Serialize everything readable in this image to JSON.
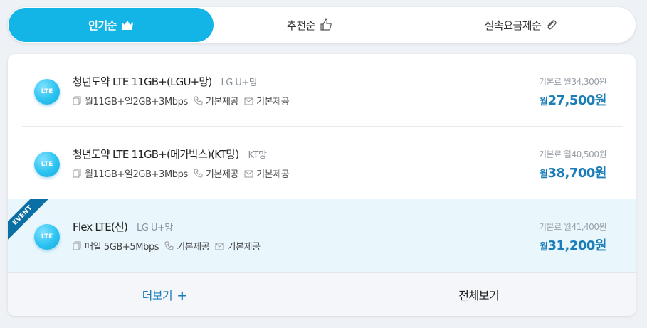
{
  "tabs": [
    {
      "label": "인기순",
      "icon": "crown-icon",
      "active": true
    },
    {
      "label": "추천순",
      "icon": "thumbs-up-icon",
      "active": false
    },
    {
      "label": "실속요금제순",
      "icon": "paperclip-icon",
      "active": false
    }
  ],
  "plans": [
    {
      "badge": "LTE",
      "name": "청년도약 LTE 11GB+(LGU+망)",
      "network": "LG U+망",
      "data": "월11GB+일2GB+3Mbps",
      "voice": "기본제공",
      "sms": "기본제공",
      "original_price": "기본료 월34,300원",
      "sale_prefix": "월",
      "sale_price": "27,500원",
      "event": false
    },
    {
      "badge": "LTE",
      "name": "청년도약 LTE 11GB+(메가박스)(KT망)",
      "network": "KT망",
      "data": "월11GB+일2GB+3Mbps",
      "voice": "기본제공",
      "sms": "기본제공",
      "original_price": "기본료 월40,500원",
      "sale_prefix": "월",
      "sale_price": "38,700원",
      "event": false
    },
    {
      "badge": "LTE",
      "name": "Flex LTE(신)",
      "network": "LG U+망",
      "data": "매일 5GB+5Mbps",
      "voice": "기본제공",
      "sms": "기본제공",
      "original_price": "기본료 월41,400원",
      "sale_prefix": "월",
      "sale_price": "31,200원",
      "event": true,
      "event_label": "EVENT"
    }
  ],
  "footer": {
    "more_label": "더보기",
    "more_icon": "+",
    "all_label": "전체보기"
  },
  "colors": {
    "accent": "#13b5e6",
    "price": "#1a7db8",
    "event_ribbon": "#0a6fa3",
    "event_bg": "#e9f7fd"
  }
}
